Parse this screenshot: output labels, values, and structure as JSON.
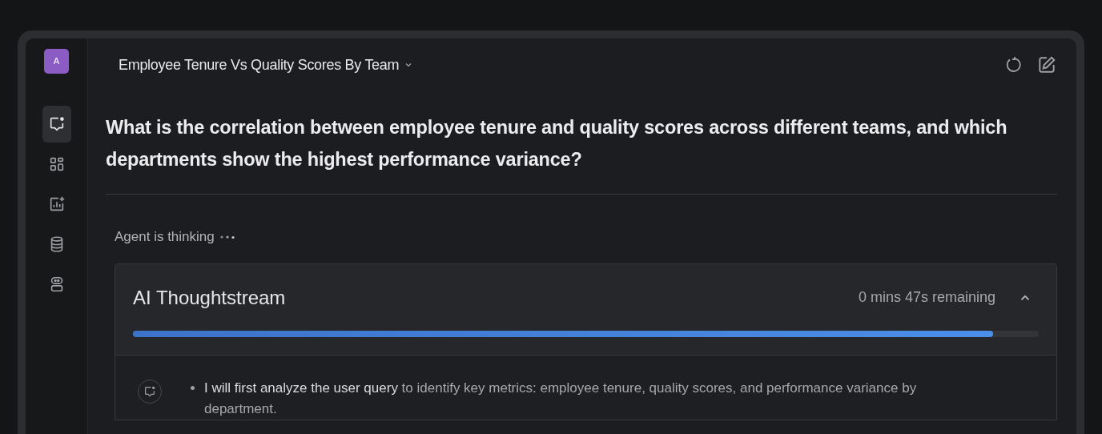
{
  "sidebar": {
    "avatar": "A",
    "items": [
      {
        "kind": "chat",
        "selected": true
      },
      {
        "kind": "grid",
        "selected": false
      },
      {
        "kind": "chart",
        "selected": false
      },
      {
        "kind": "database",
        "selected": false
      },
      {
        "kind": "agent",
        "selected": false
      }
    ]
  },
  "header": {
    "title": "Employee Tenure Vs Quality Scores By Team"
  },
  "question": "What is the correlation between employee tenure and quality scores across different teams, and which departments show the highest performance variance?",
  "status": "Agent is thinking",
  "thoughtstream": {
    "title": "AI Thoughtstream",
    "remaining": "0 mins 47s remaining",
    "expanded": true,
    "level": 0.95,
    "steps": [
      {
        "text": "**I will first analyze the user query** to identify key metrics: employee tenure, quality scores, and performance variance by department."
      }
    ]
  }
}
